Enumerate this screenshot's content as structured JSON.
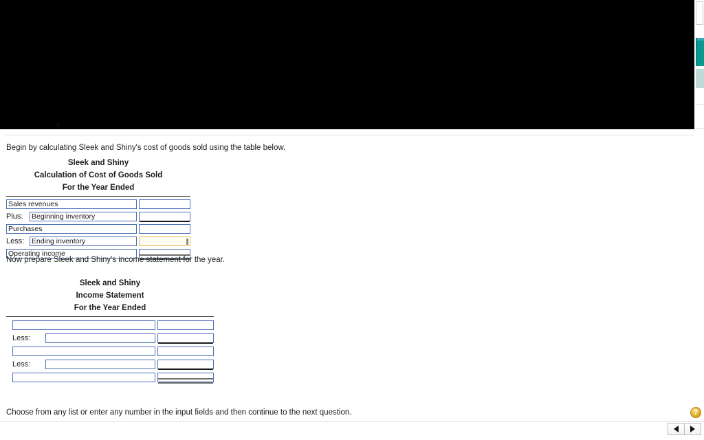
{
  "occluded_region": {
    "partial_text": "y"
  },
  "prompts": {
    "cogs_instruction": "Begin by calculating Sleek and Shiny's cost of goods sold using the table below.",
    "income_instruction": "Now prepare Sleek and Shiny's income statement for the year."
  },
  "cogs_statement": {
    "company": "Sleek and Shiny",
    "title": "Calculation of Cost of Goods Sold",
    "period": "For the Year Ended",
    "rows": [
      {
        "prefix": "",
        "label": "Sales revenues",
        "amount": "",
        "rule": "none"
      },
      {
        "prefix": "Plus:",
        "label": "Beginning inventory",
        "amount": "",
        "rule": "single"
      },
      {
        "prefix": "",
        "label": "Purchases",
        "amount": "",
        "rule": "none"
      },
      {
        "prefix": "Less:",
        "label": "Ending inventory",
        "amount": "",
        "rule": "none",
        "active": true
      },
      {
        "prefix": "",
        "label": "Operating income",
        "amount": "",
        "rule": "total"
      }
    ]
  },
  "income_statement": {
    "company": "Sleek and Shiny",
    "title": "Income Statement",
    "period": "For the Year Ended",
    "rows": [
      {
        "prefix": "",
        "label": "",
        "amount": "",
        "rule": "none"
      },
      {
        "prefix": "Less:",
        "label": "",
        "amount": "",
        "rule": "single"
      },
      {
        "prefix": "",
        "label": "",
        "amount": "",
        "rule": "none"
      },
      {
        "prefix": "Less:",
        "label": "",
        "amount": "",
        "rule": "single"
      },
      {
        "prefix": "",
        "label": "",
        "amount": "",
        "rule": "total"
      }
    ]
  },
  "footer": {
    "hint": "Choose from any list or enter any number in the input fields and then continue to the next question.",
    "help_label": "?",
    "prev_label": "",
    "next_label": ""
  },
  "colors": {
    "field_border": "#4a6fb5",
    "active_border": "#e8b84b",
    "help_gold": "#e3ac28",
    "rail_teal": "#069b8c"
  }
}
